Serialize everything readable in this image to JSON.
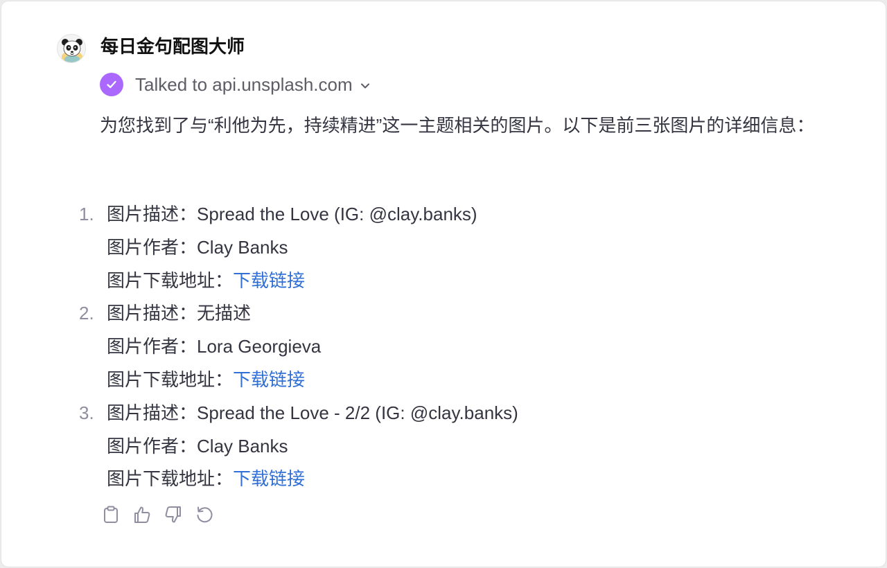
{
  "assistant": {
    "name": "每日金句配图大师",
    "avatar_icon": "panda-avatar"
  },
  "tool_call": {
    "text": "Talked to api.unsplash.com",
    "status_color": "#ab68ff"
  },
  "message": {
    "intro": "为您找到了与“利他为先，持续精进”这一主题相关的图片。以下是前三张图片的详细信息："
  },
  "results": [
    {
      "number": "1.",
      "description_label": "图片描述：",
      "description": "Spread the Love (IG: @clay.banks)",
      "author_label": "图片作者：",
      "author": "Clay Banks",
      "download_label": "图片下载地址：",
      "download_link": "下载链接"
    },
    {
      "number": "2.",
      "description_label": "图片描述：",
      "description": "无描述",
      "author_label": "图片作者：",
      "author": "Lora Georgieva",
      "download_label": "图片下载地址：",
      "download_link": "下载链接"
    },
    {
      "number": "3.",
      "description_label": "图片描述：",
      "description": "Spread the Love - 2/2 (IG: @clay.banks)",
      "author_label": "图片作者：",
      "author": "Clay Banks",
      "download_label": "图片下载地址：",
      "download_link": "下载链接"
    }
  ],
  "actions": [
    "clipboard-icon",
    "thumbs-up-icon",
    "thumbs-down-icon",
    "regenerate-icon"
  ],
  "colors": {
    "link": "#2f6fd6",
    "text": "#343541",
    "muted": "#8e8ea0"
  }
}
